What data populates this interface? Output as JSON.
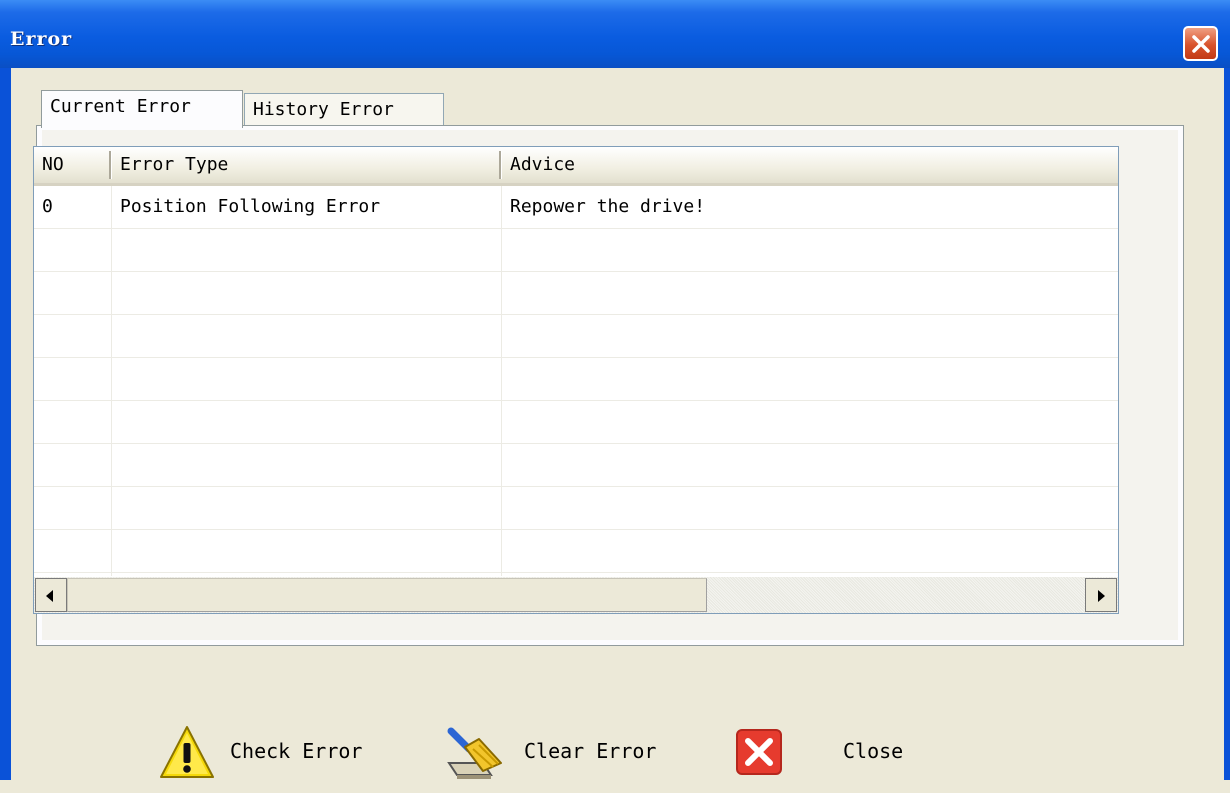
{
  "window": {
    "title": "Error"
  },
  "tabs": [
    {
      "label": "Current Error",
      "active": true
    },
    {
      "label": "History Error",
      "active": false
    }
  ],
  "table": {
    "columns": [
      "NO",
      "Error Type",
      "Advice"
    ],
    "rows": [
      [
        "0",
        "Position Following Error",
        "Repower the drive!"
      ]
    ]
  },
  "actions": {
    "check": "Check Error",
    "clear": "Clear Error",
    "close": "Close"
  },
  "icons": {
    "window_close": "close-x-icon",
    "check": "warning-icon",
    "clear": "broom-icon",
    "close": "close-icon"
  },
  "colors": {
    "titlebar": "#0a5ce0",
    "background": "#ece9d8",
    "close_red": "#d8532c"
  }
}
